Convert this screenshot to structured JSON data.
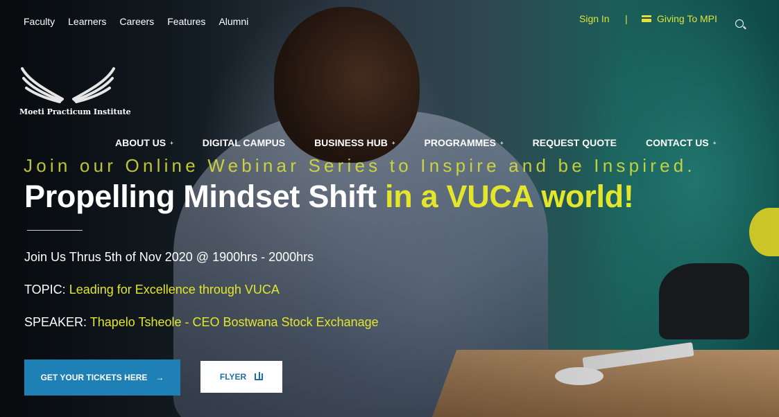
{
  "topnav": [
    "Faculty",
    "Learners",
    "Careers",
    "Features",
    "Alumni"
  ],
  "utility": {
    "signin": "Sign In",
    "separator": "|",
    "giving": "Giving To MPI",
    "giving_icon": "credit-card-icon",
    "search_icon": "search-icon"
  },
  "logo": {
    "text": "Moeti Practicum Institute",
    "icon": "wings-logo"
  },
  "mainnav": [
    {
      "label": "ABOUT US",
      "caret": "+"
    },
    {
      "label": "DIGITAL CAMPUS",
      "caret": ""
    },
    {
      "label": "BUSINESS HUB",
      "caret": "+"
    },
    {
      "label": "PROGRAMMES",
      "caret": "+"
    },
    {
      "label": "REQUEST QUOTE",
      "caret": ""
    },
    {
      "label": "CONTACT US",
      "caret": "+"
    }
  ],
  "hero": {
    "tagline": "Join our Online Webinar Series to Inspire and be Inspired.",
    "headline_white": "Propelling Mindset Shift",
    "headline_yellow": "in a VUCA world!",
    "date_line": "Join Us Thrus 5th of Nov 2020 @ 1900hrs - 2000hrs",
    "topic_label": "TOPIC:",
    "topic_value": "Leading for Excellence through VUCA",
    "speaker_label": "SPEAKER:",
    "speaker_value": "Thapelo Tsheole - CEO Bostwana Stock Exchanage"
  },
  "buttons": {
    "tickets": "GET YOUR TICKETS HERE",
    "tickets_icon": "arrow-right-icon",
    "flyer": "FLYER",
    "flyer_icon": "book-icon"
  },
  "colors": {
    "accent_yellow": "#e3e62b",
    "button_blue": "#1f80b6"
  }
}
